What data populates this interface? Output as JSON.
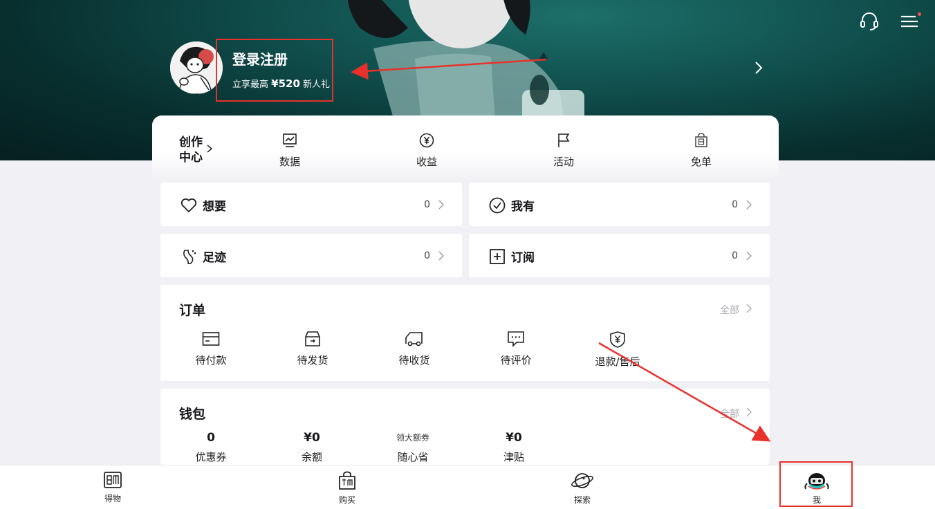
{
  "header": {
    "login_title": "登录注册",
    "login_sub_prefix": "立享最高",
    "login_sub_amount": "¥520",
    "login_sub_suffix": "新人礼"
  },
  "creator": {
    "label": "创作中心",
    "items": [
      {
        "label": "数据",
        "icon": "chart-icon"
      },
      {
        "label": "收益",
        "icon": "yen-coin-icon"
      },
      {
        "label": "活动",
        "icon": "flag-icon"
      },
      {
        "label": "免单",
        "icon": "free-bag-icon"
      }
    ]
  },
  "stats": [
    {
      "label": "想要",
      "count": "0",
      "icon": "heart-icon"
    },
    {
      "label": "我有",
      "count": "0",
      "icon": "check-circle-icon"
    },
    {
      "label": "足迹",
      "count": "0",
      "icon": "footprint-icon"
    },
    {
      "label": "订阅",
      "count": "0",
      "icon": "plus-square-icon"
    }
  ],
  "orders": {
    "title": "订单",
    "all_label": "全部",
    "items": [
      {
        "label": "待付款",
        "icon": "wallet-card-icon"
      },
      {
        "label": "待发货",
        "icon": "box-icon"
      },
      {
        "label": "待收货",
        "icon": "truck-icon"
      },
      {
        "label": "待评价",
        "icon": "comment-icon"
      },
      {
        "label": "退款/售后",
        "icon": "shield-yen-icon"
      }
    ]
  },
  "wallet": {
    "title": "钱包",
    "all_label": "全部",
    "items": [
      {
        "value": "0",
        "label": "优惠券"
      },
      {
        "value": "¥0",
        "label": "余额"
      },
      {
        "value": "领大额券",
        "label": "随心省"
      },
      {
        "value": "¥0",
        "label": "津贴"
      }
    ]
  },
  "tabbar": {
    "items": [
      {
        "label": "得物",
        "icon": "dewu-logo-icon"
      },
      {
        "label": "购买",
        "icon": "shopping-bag-icon"
      },
      {
        "label": "探索",
        "icon": "planet-icon"
      },
      {
        "label": "我",
        "icon": "me-mascot-icon"
      }
    ]
  },
  "colors": {
    "hero_teal": "#0f4d4b",
    "annotation_red": "#e8312b",
    "page_bg": "#f1f1f5"
  }
}
